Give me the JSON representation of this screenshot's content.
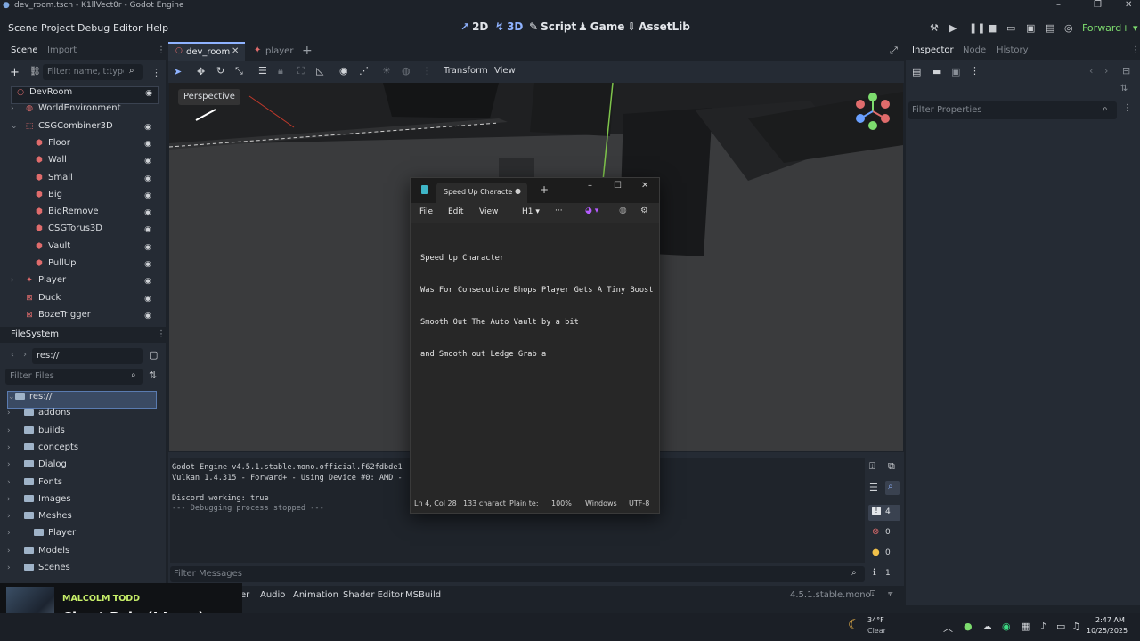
{
  "window": {
    "title": "dev_room.tscn - K1llVect0r - Godot Engine"
  },
  "menu": [
    "Scene",
    "Project",
    "Debug",
    "Editor",
    "Help"
  ],
  "workspaces": {
    "w2d": "2D",
    "w3d": "3D",
    "script": "Script",
    "game": "Game",
    "assetlib": "AssetLib"
  },
  "renderer": "Forward+",
  "scene_dock": {
    "tabs": [
      "Scene",
      "Import"
    ],
    "filter_placeholder": "Filter: name, t:type",
    "nodes": [
      {
        "name": "DevRoom",
        "indent": 0,
        "icon": "node3d-icon"
      },
      {
        "name": "WorldEnvironment",
        "indent": 1,
        "icon": "world-env-icon"
      },
      {
        "name": "CSGCombiner3D",
        "indent": 1,
        "icon": "csg-combiner-icon"
      },
      {
        "name": "Floor",
        "indent": 2,
        "icon": "csg-icon"
      },
      {
        "name": "Wall",
        "indent": 2,
        "icon": "csg-icon"
      },
      {
        "name": "Small",
        "indent": 2,
        "icon": "csg-icon"
      },
      {
        "name": "Big",
        "indent": 2,
        "icon": "csg-icon"
      },
      {
        "name": "BigRemove",
        "indent": 2,
        "icon": "csg-icon"
      },
      {
        "name": "CSGTorus3D",
        "indent": 2,
        "icon": "csg-icon"
      },
      {
        "name": "Vault",
        "indent": 2,
        "icon": "csg-icon"
      },
      {
        "name": "PullUp",
        "indent": 2,
        "icon": "csg-icon"
      },
      {
        "name": "Player",
        "indent": 1,
        "icon": "character-icon"
      },
      {
        "name": "Duck",
        "indent": 1,
        "icon": "area-icon"
      },
      {
        "name": "BozeTrigger",
        "indent": 1,
        "icon": "area-icon"
      }
    ]
  },
  "filesystem": {
    "title": "FileSystem",
    "path": "res://",
    "filter_placeholder": "Filter Files",
    "items": [
      {
        "name": "res://",
        "indent": 0
      },
      {
        "name": "addons",
        "indent": 1
      },
      {
        "name": "builds",
        "indent": 1
      },
      {
        "name": "concepts",
        "indent": 1
      },
      {
        "name": "Dialog",
        "indent": 1
      },
      {
        "name": "Fonts",
        "indent": 1
      },
      {
        "name": "Images",
        "indent": 1
      },
      {
        "name": "Meshes",
        "indent": 1
      },
      {
        "name": "Player",
        "indent": 2
      },
      {
        "name": "Models",
        "indent": 1
      },
      {
        "name": "Scenes",
        "indent": 1
      }
    ]
  },
  "editor_tabs": {
    "tab1": "dev_room",
    "tab2": "player"
  },
  "viewport_toolbar": {
    "transform": "Transform",
    "view": "View",
    "perspective": "Perspective"
  },
  "notepad": {
    "tab_title": "Speed Up Characte",
    "menu": {
      "file": "File",
      "edit": "Edit",
      "view": "View",
      "heading": "H1"
    },
    "lines": [
      "Speed Up Character",
      "Was For Consecutive Bhops Player Gets A Tiny Boost",
      "Smooth Out The Auto Vault by a bit",
      "and Smooth out Ledge Grab a"
    ],
    "status": {
      "pos": "Ln 4, Col 28",
      "chars": "133 charact",
      "type": "Plain te:",
      "zoom": "100%",
      "eol": "Windows",
      "enc": "UTF-8"
    }
  },
  "output": {
    "lines": [
      "Godot Engine v4.5.1.stable.mono.official.f62fdbde1",
      "Vulkan 1.4.315 - Forward+ - Using Device #0: AMD -",
      "",
      "Discord working: true",
      "--- Debugging process stopped ---"
    ],
    "filter_placeholder": "Filter Messages",
    "badges": {
      "log": "4",
      "errors": "0",
      "warnings": "0",
      "messages": "1"
    }
  },
  "bottom_tabs": [
    "er",
    "Audio",
    "Animation",
    "Shader Editor",
    "MSBuild"
  ],
  "version": "4.5.1.stable.mono",
  "inspector": {
    "tabs": [
      "Inspector",
      "Node",
      "History"
    ],
    "filter_placeholder": "Filter Properties"
  },
  "media": {
    "artist": "MALCOLM TODD",
    "title": "Chest Pain (I Love)"
  },
  "taskbar": {
    "weather_temp": "34°F",
    "weather_desc": "Clear",
    "time": "2:47 AM",
    "date": "10/25/2025"
  },
  "colors": {
    "accent": "#8fb3ff",
    "bg": "#1d2229",
    "panel": "#252b34"
  }
}
